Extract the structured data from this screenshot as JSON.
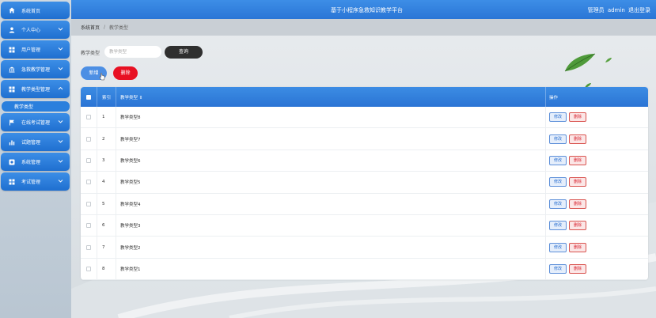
{
  "header": {
    "title": "基于小程序急救知识教学平台",
    "role": "管理员",
    "username": "admin",
    "logout": "退出登录"
  },
  "sidebar": {
    "items": [
      {
        "label": "系统首页",
        "icon": "home-icon"
      },
      {
        "label": "个人中心",
        "icon": "person-icon"
      },
      {
        "label": "用户管理",
        "icon": "grid-icon"
      },
      {
        "label": "急救教学管理",
        "icon": "bank-icon"
      },
      {
        "label": "教学类型管理",
        "icon": "grid-icon"
      },
      {
        "label": "在线考试管理",
        "icon": "flag-icon"
      },
      {
        "label": "试题管理",
        "icon": "chart-icon"
      },
      {
        "label": "系统管理",
        "icon": "gear-icon"
      },
      {
        "label": "考试管理",
        "icon": "grid-icon"
      }
    ],
    "active_sub": "教学类型"
  },
  "breadcrumb": {
    "home": "系统首页",
    "current": "教学类型"
  },
  "search": {
    "label": "教学类型",
    "placeholder": "教学类型",
    "query_label": "查询"
  },
  "actions": {
    "add_label": "新增",
    "delete_label": "删除"
  },
  "table": {
    "columns": [
      "索引",
      "教学类型 ⇕",
      "操作"
    ],
    "rows": [
      {
        "index": "1",
        "type": "教学类型8"
      },
      {
        "index": "2",
        "type": "教学类型7"
      },
      {
        "index": "3",
        "type": "教学类型6"
      },
      {
        "index": "4",
        "type": "教学类型5"
      },
      {
        "index": "5",
        "type": "教学类型4"
      },
      {
        "index": "6",
        "type": "教学类型3"
      },
      {
        "index": "7",
        "type": "教学类型2"
      },
      {
        "index": "8",
        "type": "教学类型1"
      }
    ],
    "edit_label": "修改",
    "remove_label": "删除"
  },
  "colors": {
    "primary": "#2a76d6",
    "danger": "#e81123",
    "dark": "#2f2f2f"
  }
}
